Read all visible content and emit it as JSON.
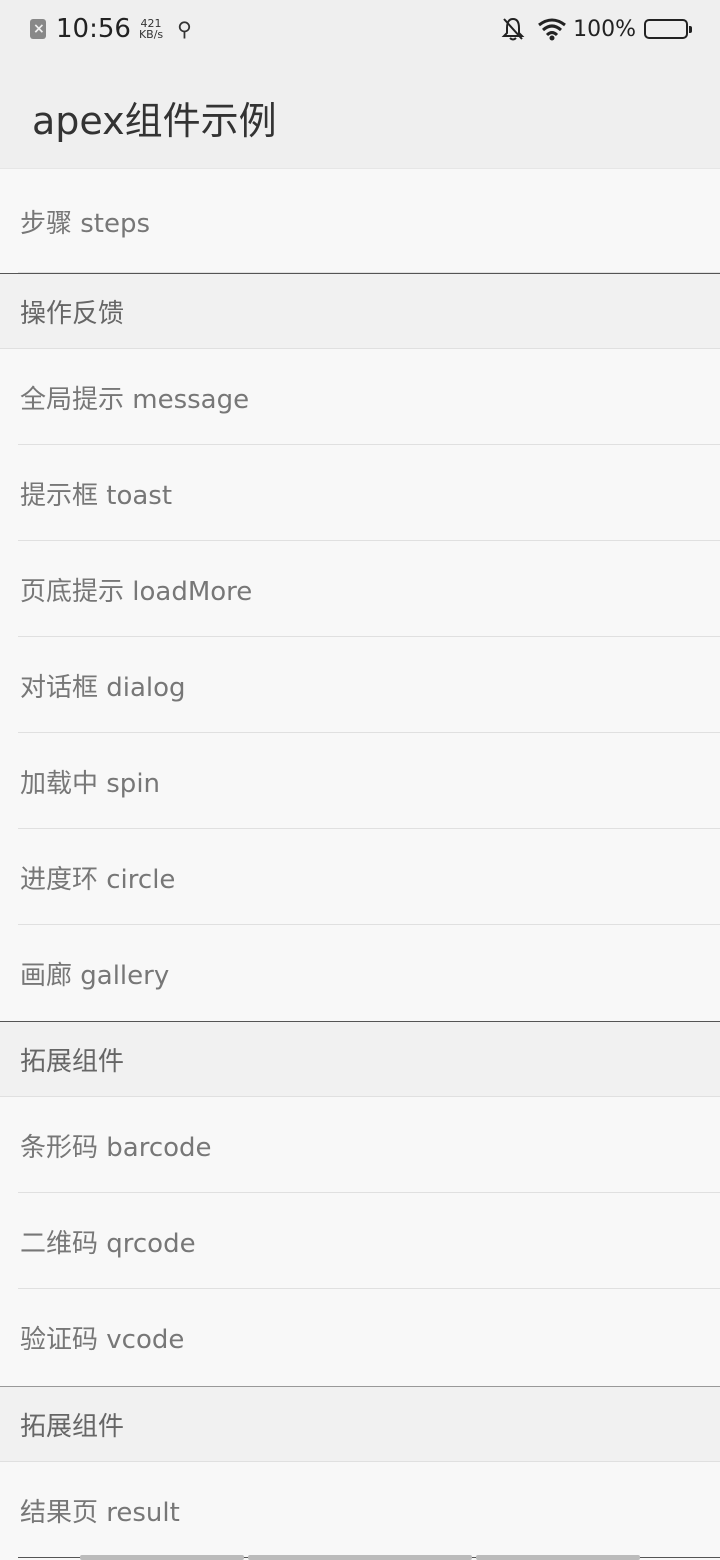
{
  "status": {
    "time": "10:56",
    "net_speed_value": "421",
    "net_speed_unit": "KB/s",
    "battery": "100%",
    "icons": [
      "sim-error-icon",
      "usb-icon",
      "mute-bell-icon",
      "wifi-icon",
      "battery-icon"
    ]
  },
  "app": {
    "title": "apex组件示例"
  },
  "list": {
    "steps": "步骤 steps",
    "section_feedback": "操作反馈",
    "message": "全局提示 message",
    "toast": "提示框 toast",
    "loadmore": "页底提示 loadMore",
    "dialog": "对话框 dialog",
    "spin": "加载中 spin",
    "circle": "进度环 circle",
    "gallery": "画廊 gallery",
    "section_ext1": "拓展组件",
    "barcode": "条形码 barcode",
    "qrcode": "二维码 qrcode",
    "vcode": "验证码 vcode",
    "section_ext2": "拓展组件",
    "result": "结果页 result"
  }
}
